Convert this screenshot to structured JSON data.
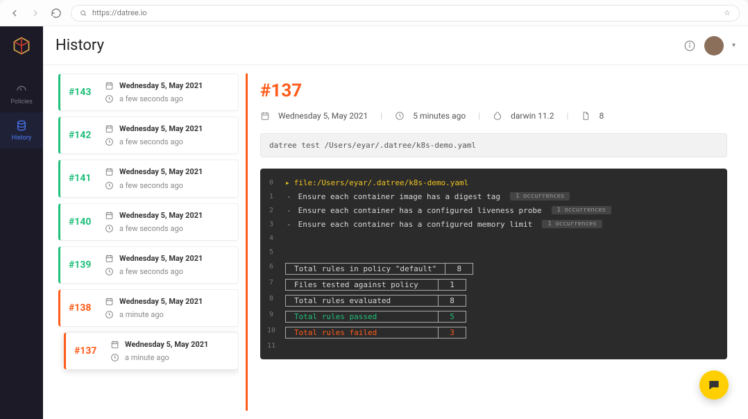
{
  "browser": {
    "url": "https://datree.io"
  },
  "page": {
    "title": "History"
  },
  "nav": {
    "items": [
      {
        "label": "Policies"
      },
      {
        "label": "History"
      }
    ]
  },
  "history": [
    {
      "id": "#143",
      "status": "green",
      "date": "Wednesday 5, May 2021",
      "ago": "a few seconds ago",
      "selected": false
    },
    {
      "id": "#142",
      "status": "green",
      "date": "Wednesday 5, May 2021",
      "ago": "a few seconds ago",
      "selected": false
    },
    {
      "id": "#141",
      "status": "green",
      "date": "Wednesday 5, May 2021",
      "ago": "a few seconds ago",
      "selected": false
    },
    {
      "id": "#140",
      "status": "green",
      "date": "Wednesday 5, May 2021",
      "ago": "a few seconds ago",
      "selected": false
    },
    {
      "id": "#139",
      "status": "green",
      "date": "Wednesday 5, May 2021",
      "ago": "a few seconds ago",
      "selected": false
    },
    {
      "id": "#138",
      "status": "orange",
      "date": "Wednesday 5, May 2021",
      "ago": "a minute ago",
      "selected": false
    },
    {
      "id": "#137",
      "status": "orange",
      "date": "Wednesday 5, May 2021",
      "ago": "a minute ago",
      "selected": true
    }
  ],
  "detail": {
    "id": "#137",
    "date": "Wednesday 5, May 2021",
    "ago": "5 minutes ago",
    "os": "darwin 11.2",
    "count": "8",
    "command": "datree test /Users/eyar/.datree/k8s-demo.yaml",
    "file_label": "file:/Users/eyar/.datree/k8s-demo.yaml",
    "occurrence_label": "1 occurrences",
    "rules": [
      "Ensure each container image has a digest tag",
      "Ensure each container has a configured liveness probe",
      "Ensure each container has a configured memory limit"
    ],
    "summary": [
      {
        "label": "Total rules in policy \"default\"",
        "value": "8",
        "cls": ""
      },
      {
        "label": "Files tested against policy",
        "value": "1",
        "cls": ""
      },
      {
        "label": "Total rules evaluated",
        "value": "8",
        "cls": ""
      },
      {
        "label": "Total rules passed",
        "value": "5",
        "cls": "pass"
      },
      {
        "label": "Total rules failed",
        "value": "3",
        "cls": "fail"
      }
    ],
    "gutters": [
      "0",
      "1",
      "2",
      "3",
      "4",
      "5",
      "6",
      "7",
      "8",
      "9",
      "10",
      "11"
    ]
  }
}
